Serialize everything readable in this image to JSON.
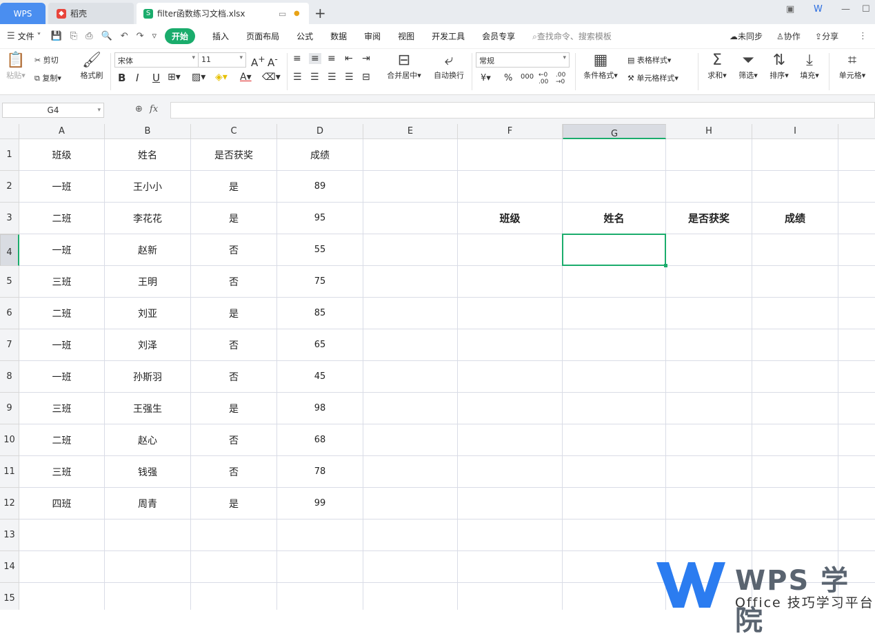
{
  "tabs": {
    "wps": "WPS",
    "daoke": "稻壳",
    "file": "filter函数练习文档.xlsx"
  },
  "menu": {
    "file": "文件",
    "items": [
      "开始",
      "插入",
      "页面布局",
      "公式",
      "数据",
      "审阅",
      "视图",
      "开发工具",
      "会员专享"
    ],
    "search_placeholder": "查找命令、搜索模板",
    "sync": "未同步",
    "collab": "协作",
    "share": "分享"
  },
  "ribbon": {
    "paste": "粘贴",
    "cut": "剪切",
    "copy": "复制",
    "format_painter": "格式刷",
    "font": "宋体",
    "font_size": "11",
    "merge": "合并居中",
    "wrap": "自动换行",
    "number_format": "常规",
    "cond_format": "条件格式",
    "table_style": "表格样式",
    "cell_style": "单元格样式",
    "sum": "求和",
    "filter": "筛选",
    "sort": "排序",
    "fill": "填充",
    "cell": "单元格"
  },
  "formula_bar": {
    "name_box": "G4",
    "fx": "fx",
    "value": ""
  },
  "sheet": {
    "columns": [
      "A",
      "B",
      "C",
      "D",
      "E",
      "F",
      "G",
      "H",
      "I"
    ],
    "rows": [
      "1",
      "2",
      "3",
      "4",
      "5",
      "6",
      "7",
      "8",
      "9",
      "10",
      "11",
      "12",
      "13",
      "14",
      "15"
    ],
    "selected_cell": "G4",
    "table_header": [
      "班级",
      "姓名",
      "是否获奖",
      "成绩"
    ],
    "table_rows": [
      [
        "一班",
        "王小小",
        "是",
        "89"
      ],
      [
        "二班",
        "李花花",
        "是",
        "95"
      ],
      [
        "一班",
        "赵新",
        "否",
        "55"
      ],
      [
        "三班",
        "王明",
        "否",
        "75"
      ],
      [
        "二班",
        "刘亚",
        "是",
        "85"
      ],
      [
        "一班",
        "刘泽",
        "否",
        "65"
      ],
      [
        "一班",
        "孙斯羽",
        "否",
        "45"
      ],
      [
        "三班",
        "王强生",
        "是",
        "98"
      ],
      [
        "二班",
        "赵心",
        "否",
        "68"
      ],
      [
        "三班",
        "钱强",
        "否",
        "78"
      ],
      [
        "四班",
        "周青",
        "是",
        "99"
      ]
    ],
    "result_header": [
      "班级",
      "姓名",
      "是否获奖",
      "成绩"
    ]
  },
  "watermark": {
    "title": "WPS 学院",
    "subtitle": "Office 技巧学习平台"
  },
  "colors": {
    "accent": "#1aac6c",
    "wps_tab": "#4a8ef0"
  }
}
